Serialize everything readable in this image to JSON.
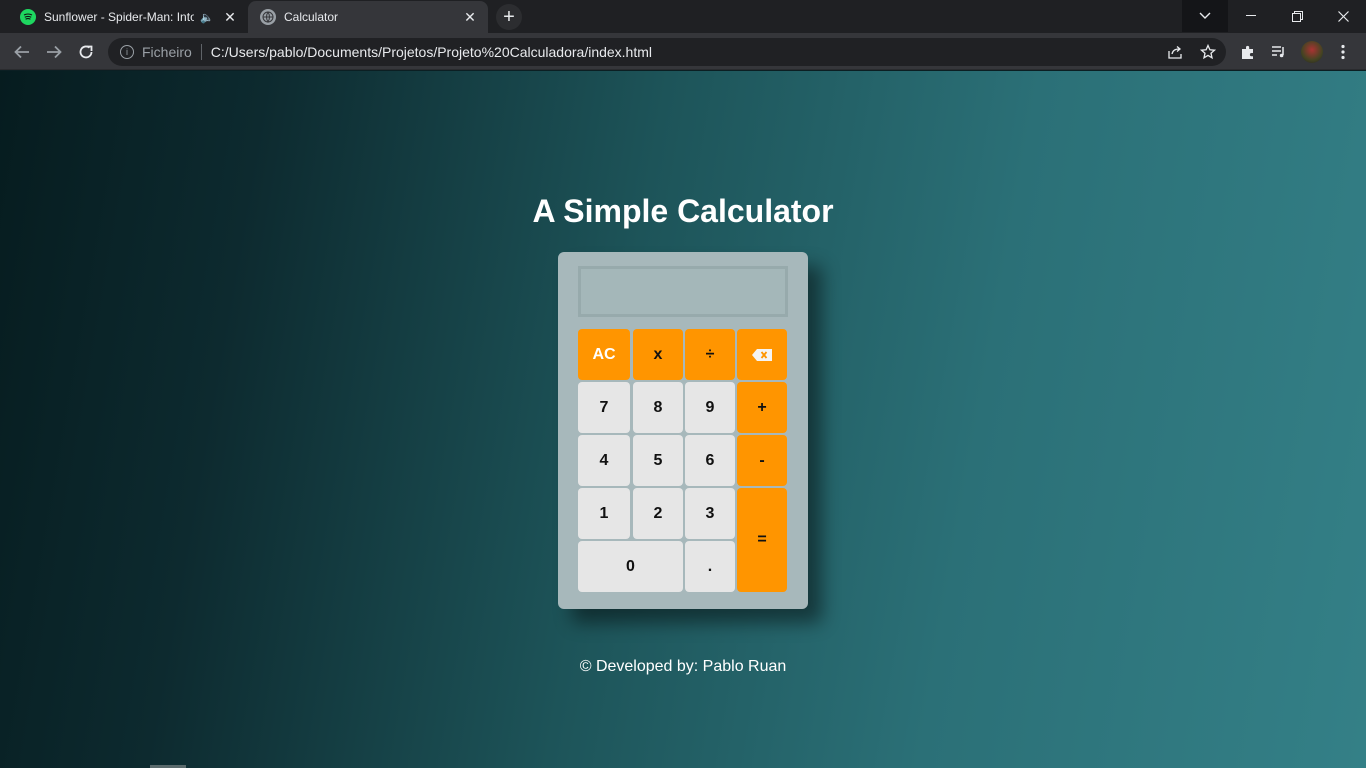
{
  "browser": {
    "tabs": [
      {
        "title": "Sunflower - Spider-Man: Into",
        "icon": "spotify-icon",
        "audio": "🔈"
      },
      {
        "title": "Calculator",
        "icon": "globe-icon"
      }
    ],
    "address": {
      "scheme": "Ficheiro",
      "url": "C:/Users/pablo/Documents/Projetos/Projeto%20Calculadora/index.html"
    }
  },
  "page": {
    "title": "A Simple Calculator",
    "credit": "© Developed by: Pablo Ruan"
  },
  "calculator": {
    "display": "",
    "keys": {
      "ac": "AC",
      "multiply": "x",
      "divide": "÷",
      "seven": "7",
      "eight": "8",
      "nine": "9",
      "plus": "+",
      "four": "4",
      "five": "5",
      "six": "6",
      "minus": "-",
      "one": "1",
      "two": "2",
      "three": "3",
      "equals": "=",
      "zero": "0",
      "dot": "."
    }
  },
  "colors": {
    "operator": "#ff9500",
    "number": "#e6e6e6",
    "calculator_body": "#a7b8bb"
  }
}
